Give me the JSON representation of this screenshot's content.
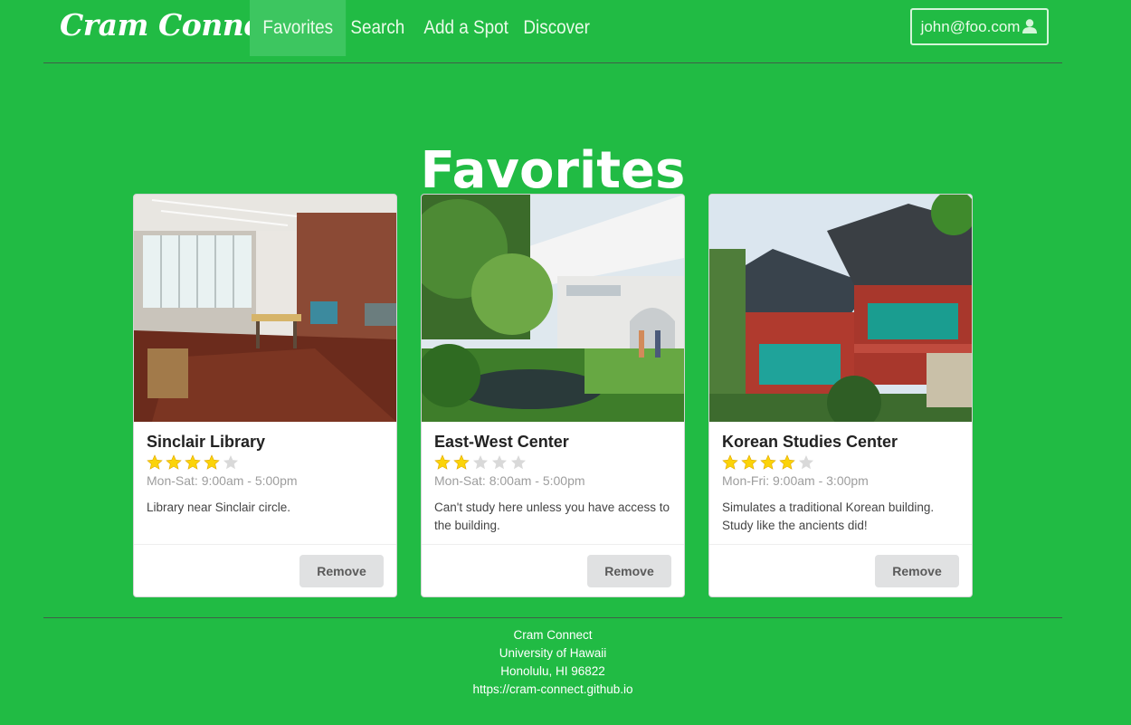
{
  "navbar": {
    "brand": "Cram Connect",
    "items": [
      {
        "label": "Favorites",
        "active": true
      },
      {
        "label": "Search",
        "active": false
      },
      {
        "label": "Add a Spot",
        "active": false
      },
      {
        "label": "Discover",
        "active": false
      }
    ],
    "user": {
      "email": "john@foo.com",
      "icon": "user-icon"
    }
  },
  "page": {
    "title": "Favorites"
  },
  "cards": [
    {
      "name": "Sinclair Library",
      "rating": 4,
      "max_rating": 5,
      "hours": "Mon-Sat: 9:00am - 5:00pm",
      "description": "Library near Sinclair circle.",
      "remove_label": "Remove",
      "image": "library interior photo"
    },
    {
      "name": "East-West Center",
      "rating": 2,
      "max_rating": 5,
      "hours": "Mon-Sat: 8:00am - 5:00pm",
      "description": "Can't study here unless you have access to the building.",
      "remove_label": "Remove",
      "image": "building with garden photo"
    },
    {
      "name": "Korean Studies Center",
      "rating": 4,
      "max_rating": 5,
      "hours": "Mon-Fri: 9:00am - 3:00pm",
      "description": "Simulates a traditional Korean building. Study like the ancients did!",
      "remove_label": "Remove",
      "image": "traditional korean building photo"
    }
  ],
  "footer": {
    "line1": "Cram Connect",
    "line2": "University of Hawaii",
    "line3": "Honolulu, HI 96822",
    "line4": "https://cram-connect.github.io"
  },
  "colors": {
    "background": "#21bb44",
    "star_filled": "#fbd308",
    "star_empty": "#d9d9d9",
    "button": "#e0e1e2"
  }
}
